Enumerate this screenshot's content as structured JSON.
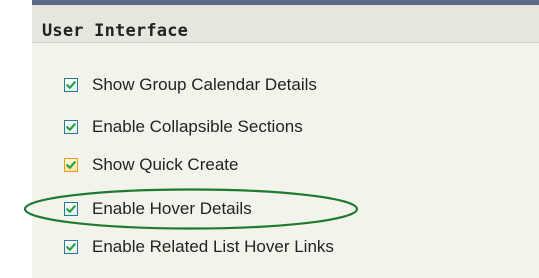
{
  "section": {
    "title": "User Interface"
  },
  "options": [
    {
      "label": "Show Group Calendar Details",
      "checked": true,
      "style": "normal"
    },
    {
      "label": "Enable Collapsible Sections",
      "checked": true,
      "style": "normal"
    },
    {
      "label": "Show Quick Create",
      "checked": true,
      "style": "hover-orange"
    },
    {
      "label": "Enable Hover Details",
      "checked": true,
      "style": "normal",
      "highlighted": true
    },
    {
      "label": "Enable Related List Hover Links",
      "checked": true,
      "style": "normal"
    }
  ],
  "colors": {
    "panel_background": "#f3f3ec",
    "header_background": "#e6e6df",
    "header_topbar": "#5f6a86",
    "checkbox_border": "#2a7a95",
    "checkmark": "#18a23a",
    "checkbox_hover_border": "#e3a021",
    "highlight_ellipse": "#1e7a30"
  },
  "icons": {
    "checkbox_checked": "check-icon",
    "annotation": "ellipse-highlight"
  }
}
